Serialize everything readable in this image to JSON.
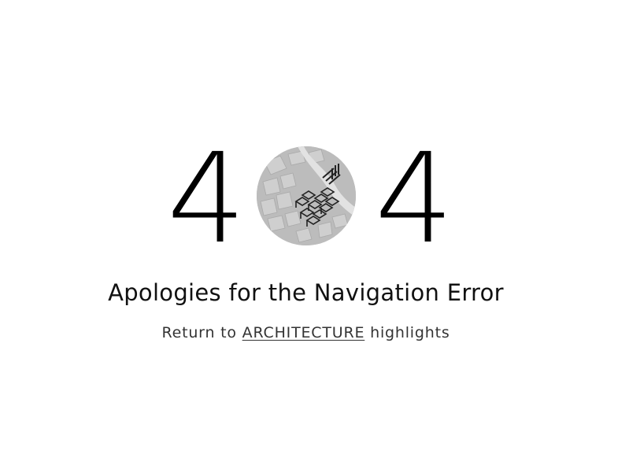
{
  "error": {
    "digit_first": "4",
    "digit_last": "4",
    "middle_image": "architecture-map-circle-image",
    "headline": "Apologies for the Navigation Error",
    "return_prefix": "Return to",
    "return_link": "ARCHITECTURE",
    "return_suffix": "highlights"
  },
  "colors": {
    "background": "#ffffff",
    "text": "#111111",
    "subtext": "#333333",
    "circle_bg": "#bdbdbd"
  }
}
